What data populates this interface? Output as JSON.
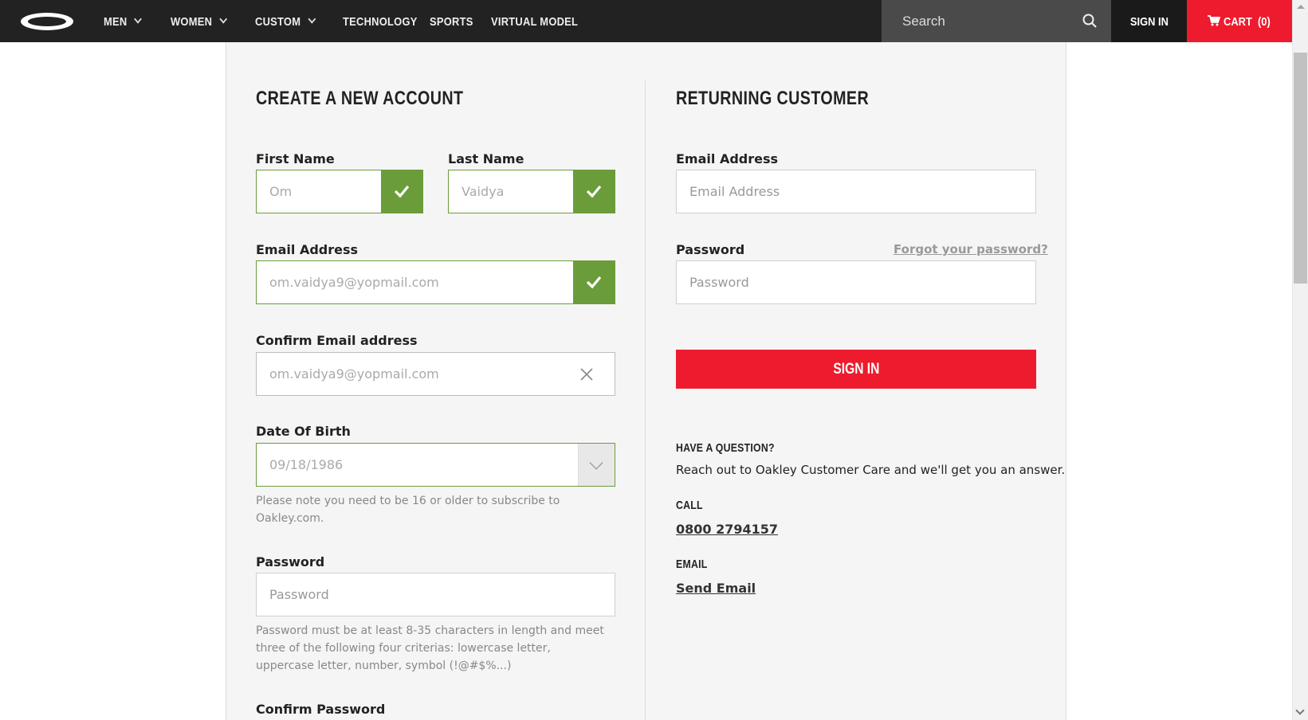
{
  "nav": {
    "items": [
      {
        "label": "MEN",
        "has_dropdown": true
      },
      {
        "label": "WOMEN",
        "has_dropdown": true
      },
      {
        "label": "CUSTOM",
        "has_dropdown": true
      },
      {
        "label": "TECHNOLOGY",
        "has_dropdown": false
      },
      {
        "label": "SPORTS",
        "has_dropdown": false
      },
      {
        "label": "VIRTUAL MODEL",
        "has_dropdown": false
      }
    ],
    "search_placeholder": "Search",
    "sign_in": "SIGN IN",
    "cart_label": "CART",
    "cart_count": "(0)",
    "colors": {
      "bar": "#222222",
      "search": "#4a4a4a",
      "cart": "#ee1b2e"
    }
  },
  "create_account": {
    "heading": "CREATE A NEW ACCOUNT",
    "first_name": {
      "label": "First Name",
      "value": "Om"
    },
    "last_name": {
      "label": "Last Name",
      "value": "Vaidya"
    },
    "email": {
      "label": "Email Address",
      "value": "om.vaidya9@yopmail.com"
    },
    "confirm_email": {
      "label": "Confirm Email address",
      "value": "om.vaidya9@yopmail.com"
    },
    "dob": {
      "label": "Date Of Birth",
      "value": "09/18/1986",
      "note": "Please note you need to be 16 or older to subscribe to Oakley.com."
    },
    "password": {
      "label": "Password",
      "placeholder": "Password",
      "note": "Password must be at least 8-35 characters in length and meet three of the following four criterias: lowercase letter, uppercase letter, number, symbol (!@#$%...)"
    },
    "confirm_password": {
      "label": "Confirm Password"
    }
  },
  "returning": {
    "heading": "RETURNING CUSTOMER",
    "email": {
      "label": "Email Address",
      "placeholder": "Email Address"
    },
    "password": {
      "label": "Password",
      "placeholder": "Password"
    },
    "forgot": "Forgot your password?",
    "sign_in_button": "SIGN IN",
    "question_heading": "HAVE A QUESTION?",
    "question_text": "Reach out to Oakley Customer Care and we'll get you an answer.",
    "call_heading": "CALL",
    "phone": "0800 2794157",
    "email_heading": "EMAIL",
    "send_email": "Send Email"
  },
  "colors": {
    "valid": "#6a9d3a",
    "accent": "#ee1b2e",
    "panel": "#f5f5f5"
  }
}
